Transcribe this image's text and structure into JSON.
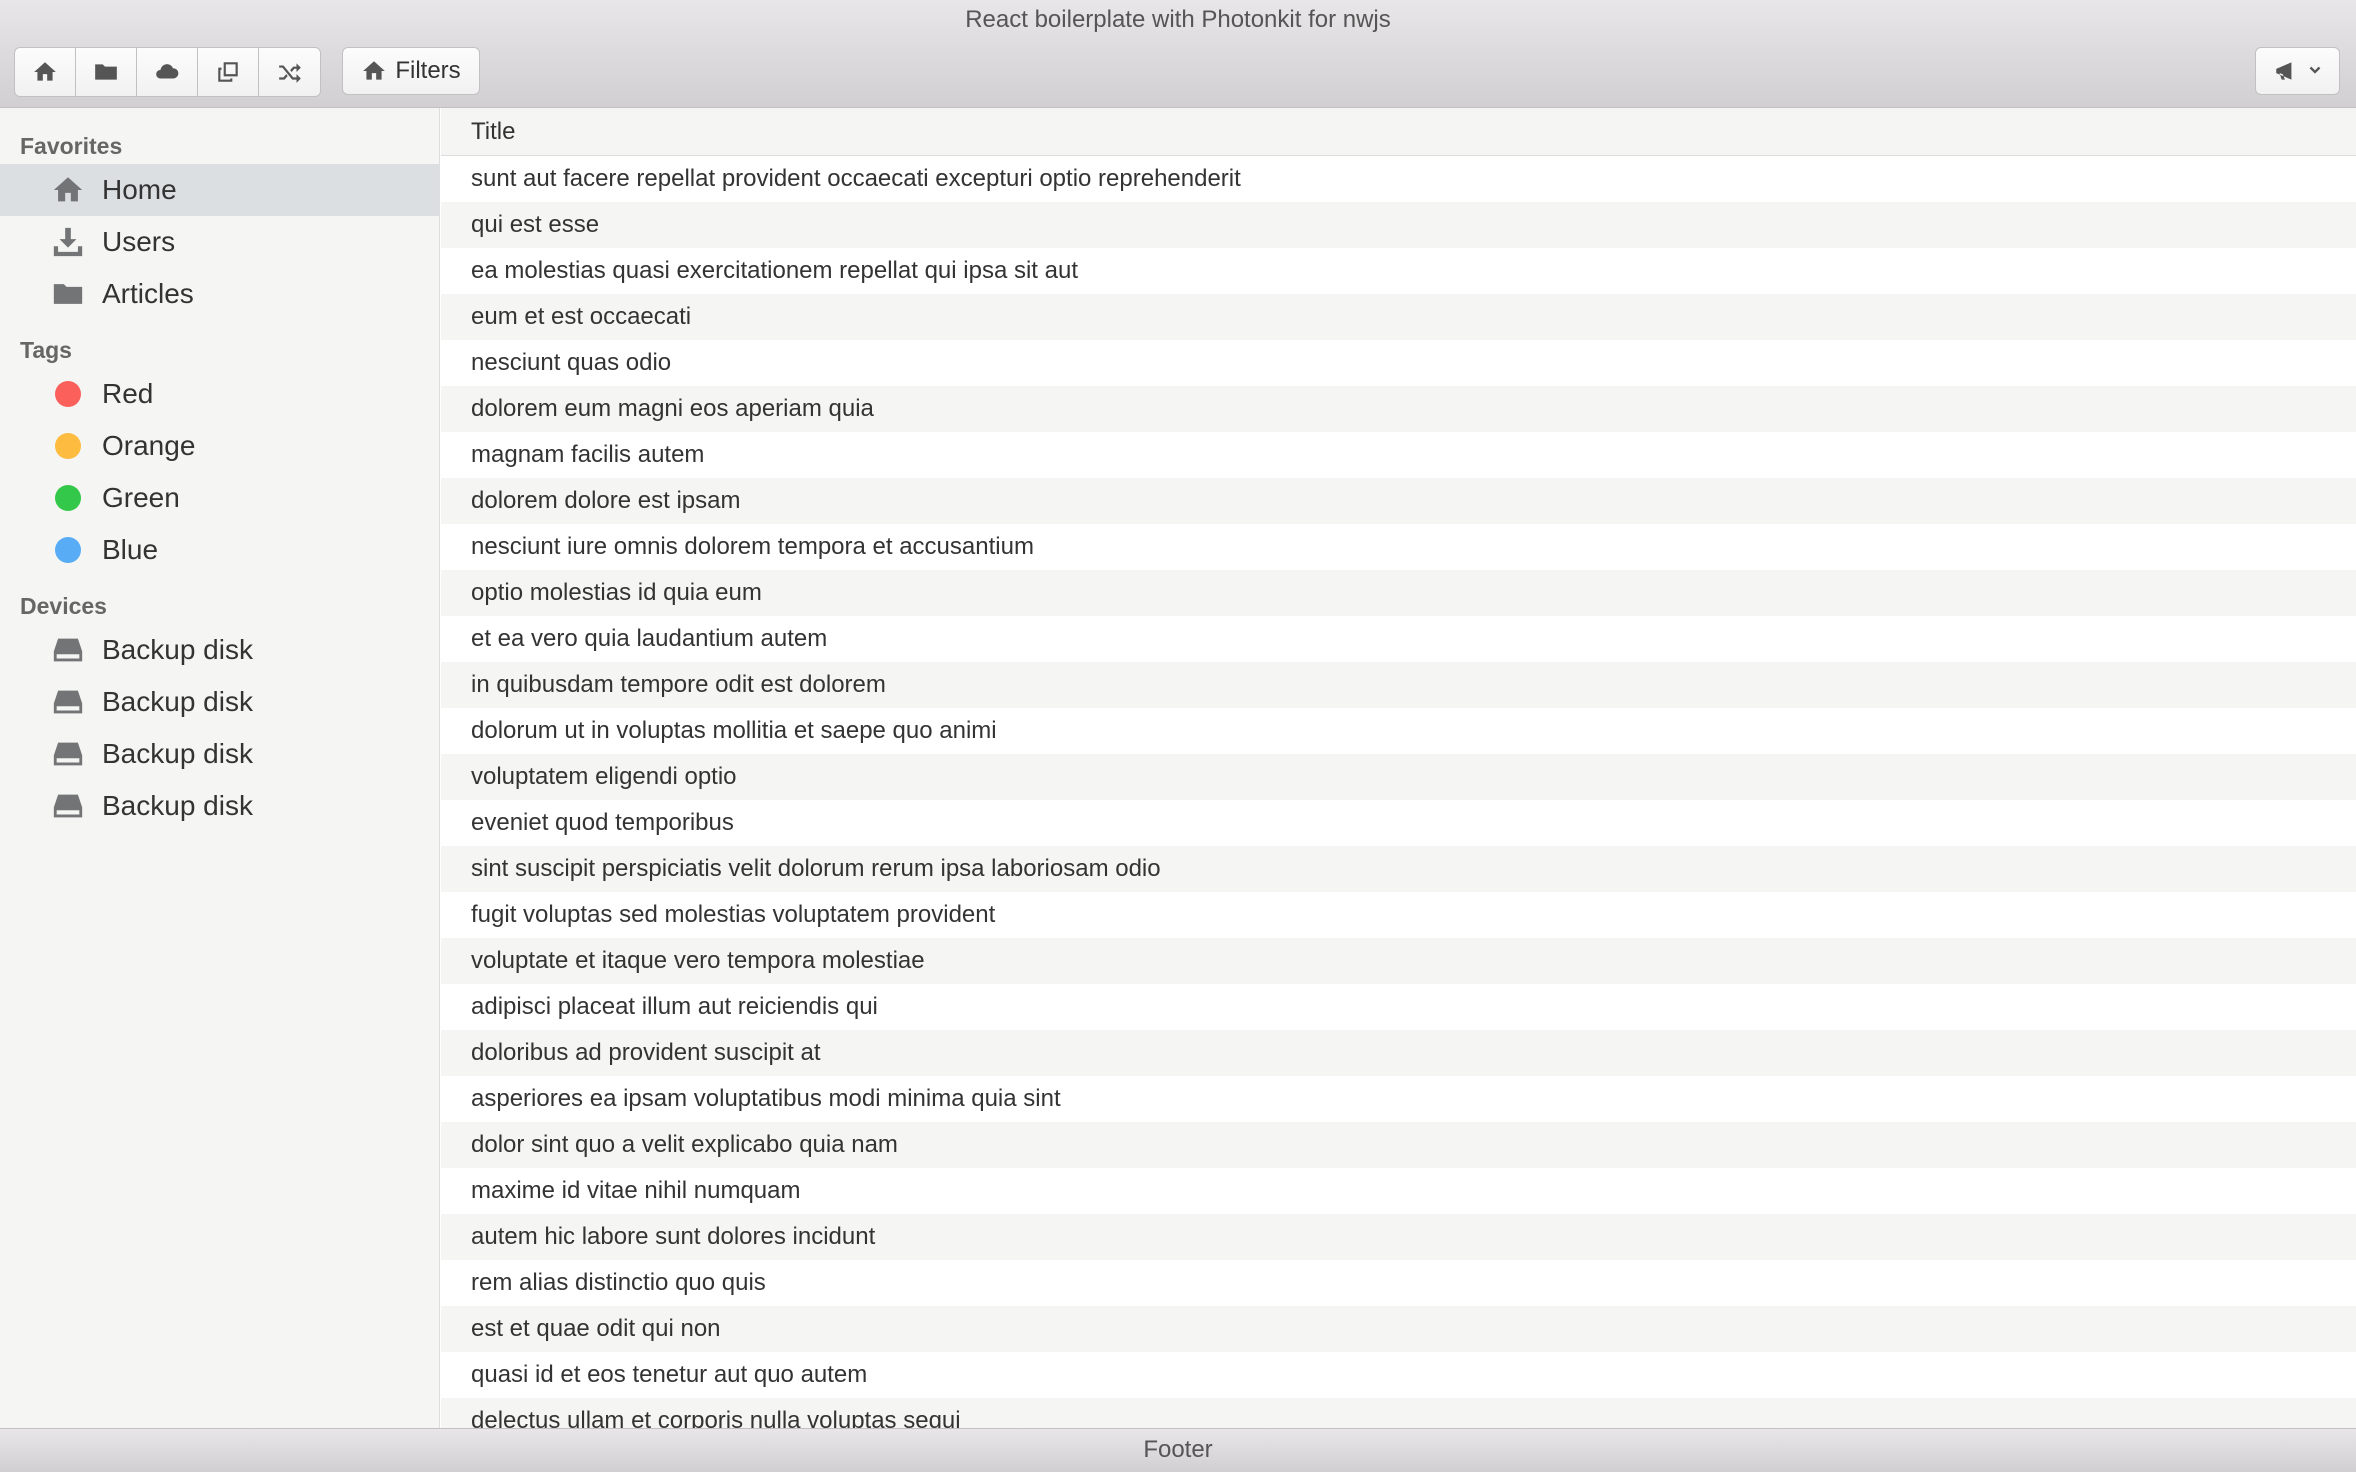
{
  "window": {
    "title": "React boilerplate with Photonkit for nwjs"
  },
  "toolbar": {
    "buttons": [
      {
        "icon": "home-icon"
      },
      {
        "icon": "folder-icon"
      },
      {
        "icon": "cloud-icon"
      },
      {
        "icon": "popup-icon"
      },
      {
        "icon": "shuffle-icon"
      }
    ],
    "filters_label": "Filters",
    "dropdown_icon": "megaphone-icon"
  },
  "sidebar": {
    "favorites_title": "Favorites",
    "favorites": [
      {
        "label": "Home",
        "icon": "home-icon",
        "active": true
      },
      {
        "label": "Users",
        "icon": "download-icon"
      },
      {
        "label": "Articles",
        "icon": "folder-icon"
      }
    ],
    "tags_title": "Tags",
    "tags": [
      {
        "label": "Red",
        "color": "#fc605b"
      },
      {
        "label": "Orange",
        "color": "#fdbc40"
      },
      {
        "label": "Green",
        "color": "#34c84a"
      },
      {
        "label": "Blue",
        "color": "#57acf5"
      }
    ],
    "devices_title": "Devices",
    "devices": [
      {
        "label": "Backup disk",
        "icon": "drive-icon"
      },
      {
        "label": "Backup disk",
        "icon": "drive-icon"
      },
      {
        "label": "Backup disk",
        "icon": "drive-icon"
      },
      {
        "label": "Backup disk",
        "icon": "drive-icon"
      }
    ]
  },
  "table": {
    "column_header": "Title",
    "rows": [
      "sunt aut facere repellat provident occaecati excepturi optio reprehenderit",
      "qui est esse",
      "ea molestias quasi exercitationem repellat qui ipsa sit aut",
      "eum et est occaecati",
      "nesciunt quas odio",
      "dolorem eum magni eos aperiam quia",
      "magnam facilis autem",
      "dolorem dolore est ipsam",
      "nesciunt iure omnis dolorem tempora et accusantium",
      "optio molestias id quia eum",
      "et ea vero quia laudantium autem",
      "in quibusdam tempore odit est dolorem",
      "dolorum ut in voluptas mollitia et saepe quo animi",
      "voluptatem eligendi optio",
      "eveniet quod temporibus",
      "sint suscipit perspiciatis velit dolorum rerum ipsa laboriosam odio",
      "fugit voluptas sed molestias voluptatem provident",
      "voluptate et itaque vero tempora molestiae",
      "adipisci placeat illum aut reiciendis qui",
      "doloribus ad provident suscipit at",
      "asperiores ea ipsam voluptatibus modi minima quia sint",
      "dolor sint quo a velit explicabo quia nam",
      "maxime id vitae nihil numquam",
      "autem hic labore sunt dolores incidunt",
      "rem alias distinctio quo quis",
      "est et quae odit qui non",
      "quasi id et eos tenetur aut quo autem",
      "delectus ullam et corporis nulla voluptas sequi"
    ]
  },
  "footer": {
    "text": "Footer"
  }
}
